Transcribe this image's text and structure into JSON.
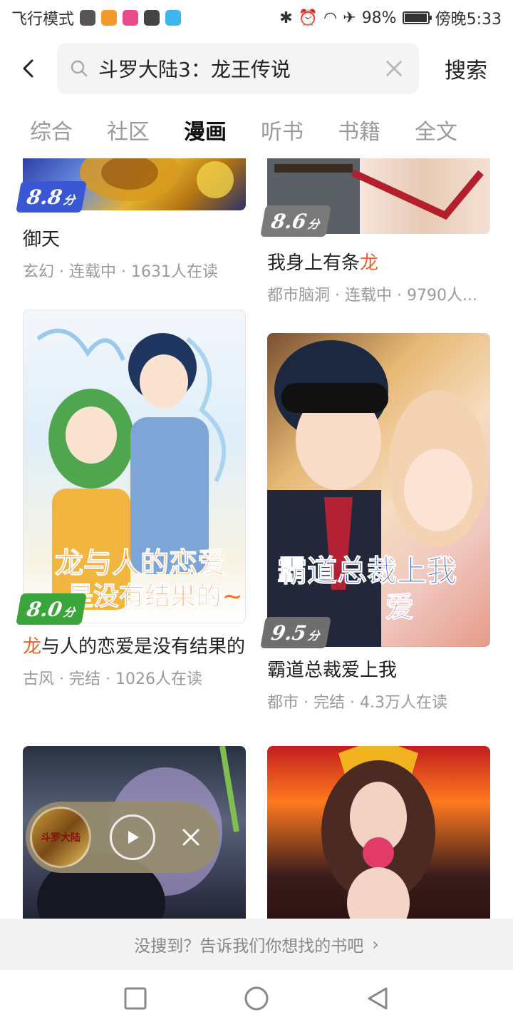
{
  "status_bar": {
    "mode_label": "飞行模式",
    "app_icon_colors": [
      "#555555",
      "#f39a2e",
      "#e84a8a",
      "#444444",
      "#3fb6f0"
    ],
    "battery_text": "98%",
    "battery_level": 0.98,
    "time": "傍晚5:33",
    "icons": [
      "bluetooth-icon",
      "alarm-icon",
      "wifi-icon",
      "airplane-icon",
      "battery-icon"
    ]
  },
  "header": {
    "query": "斗罗大陆3：龙王传说",
    "search_label": "搜索"
  },
  "tabs": [
    {
      "label": "综合",
      "active": false
    },
    {
      "label": "社区",
      "active": false
    },
    {
      "label": "漫画",
      "active": true
    },
    {
      "label": "听书",
      "active": false
    },
    {
      "label": "书籍",
      "active": false
    },
    {
      "label": "全文",
      "active": false
    }
  ],
  "results": {
    "left": [
      {
        "title": "御天",
        "meta": "玄幻 · 连载中 · 1631人在读",
        "score": "8.8",
        "score_unit": "分",
        "badge_color": "#3b57d6"
      },
      {
        "title_highlight": "龙",
        "title_rest": "与人的恋爱是没有结果的",
        "meta": "古风 · 完结 · 1026人在读",
        "score": "8.0",
        "score_unit": "分",
        "badge_color": "#3aa53a",
        "cover_text_top": "龙与人的恋爱",
        "cover_text_bottom": "是没有结果的~"
      },
      {
        "cover_only": true
      }
    ],
    "right": [
      {
        "title_rest": "我身上有条",
        "title_highlight": "龙",
        "meta": "都市脑洞 · 连载中 · 9790人...",
        "score": "8.6",
        "score_unit": "分",
        "badge_color": "#7a7a7a"
      },
      {
        "title": "霸道总裁爱上我",
        "meta": "都市 · 完结 · 4.3万人在读",
        "score": "9.5",
        "score_unit": "分",
        "badge_color": "#6e6e6e",
        "cover_text_top": "霸道总裁上我",
        "cover_text_bottom": "爱"
      },
      {
        "cover_only": true
      }
    ]
  },
  "feedback": {
    "text": "没搜到？告诉我们你想找的书吧"
  },
  "player": {
    "cover_text": "斗罗大陆"
  },
  "colors": {
    "accent": "#e8642c",
    "tab_inactive": "#9a9a9a"
  }
}
